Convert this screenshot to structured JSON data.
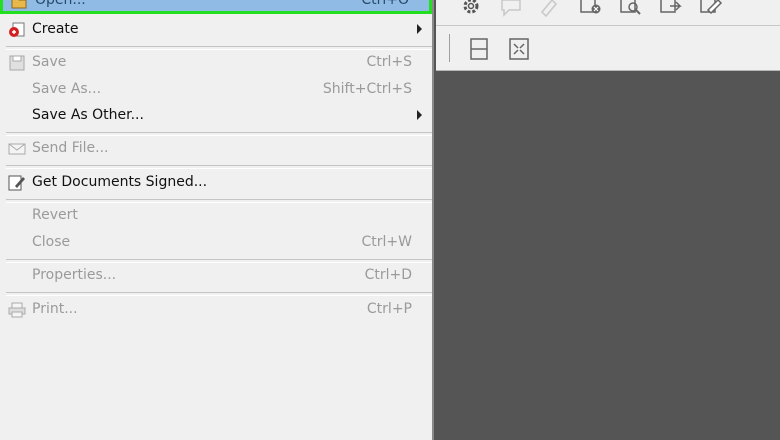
{
  "menu": {
    "highlighted": {
      "label": "Open...",
      "shortcut": "Ctrl+O",
      "icon": "open-folder-icon"
    },
    "items": [
      {
        "label": "Create",
        "shortcut": "",
        "enabled": true,
        "submenu": true,
        "icon": "create-pdf-icon"
      },
      {
        "label": "Save",
        "shortcut": "Ctrl+S",
        "enabled": false,
        "submenu": false,
        "icon": "save-disk-icon"
      },
      {
        "label": "Save As...",
        "shortcut": "Shift+Ctrl+S",
        "enabled": false,
        "submenu": false,
        "icon": ""
      },
      {
        "label": "Save As Other...",
        "shortcut": "",
        "enabled": true,
        "submenu": true,
        "icon": ""
      },
      {
        "label": "Send File...",
        "shortcut": "",
        "enabled": false,
        "submenu": false,
        "icon": "send-file-icon"
      },
      {
        "label": "Get Documents Signed...",
        "shortcut": "",
        "enabled": true,
        "submenu": false,
        "icon": "sign-document-icon"
      },
      {
        "label": "Revert",
        "shortcut": "",
        "enabled": false,
        "submenu": false,
        "icon": ""
      },
      {
        "label": "Close",
        "shortcut": "Ctrl+W",
        "enabled": false,
        "submenu": false,
        "icon": ""
      },
      {
        "label": "Properties...",
        "shortcut": "Ctrl+D",
        "enabled": false,
        "submenu": false,
        "icon": ""
      },
      {
        "label": "Print...",
        "shortcut": "Ctrl+P",
        "enabled": false,
        "submenu": false,
        "icon": "printer-icon"
      }
    ]
  },
  "toolbar": {
    "icons": [
      "gear-icon",
      "comment-icon",
      "highlight-icon",
      "close-doc-icon",
      "search-doc-icon",
      "export-icon",
      "edit-icon"
    ],
    "second_icons": [
      "fit-width-icon",
      "fit-page-icon"
    ]
  },
  "colors": {
    "highlight": "#8fbbe4",
    "highlight_border": "#22e020",
    "doc_background": "#555555",
    "menu_background": "#f0f0f0"
  }
}
